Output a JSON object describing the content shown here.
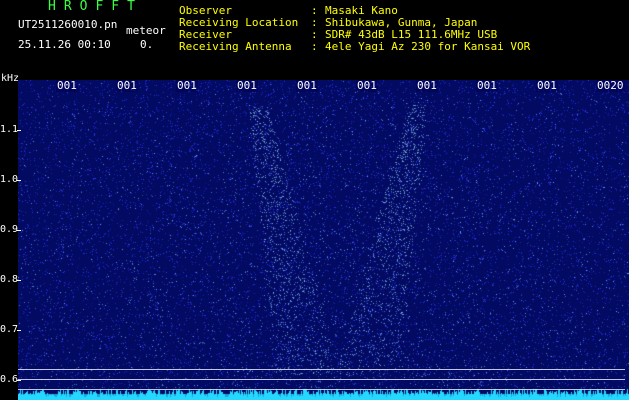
{
  "app": {
    "title": "HROFFT"
  },
  "file": {
    "name": "UT2511260010.pn",
    "detection_label": "meteor",
    "datetime": "25.11.26 00:10",
    "count": "0."
  },
  "info": {
    "observer": {
      "label": "Observer",
      "value": "Masaki Kano"
    },
    "location": {
      "label": "Receiving Location",
      "value": "Shibukawa, Gunma, Japan"
    },
    "receiver": {
      "label": "Receiver",
      "value": "SDR# 43dB L15 111.6MHz USB"
    },
    "antenna": {
      "label": "Receiving Antenna",
      "value": "4ele Yagi Az 230 for Kansai VOR"
    },
    "separator": ":"
  },
  "spectrogram": {
    "unit_label": "kHz",
    "y_labels": [
      "1.1",
      "1.0",
      "0.9",
      "0.8",
      "0.7",
      "0.6"
    ],
    "time_labels": [
      "001",
      "001",
      "001",
      "001",
      "001",
      "001",
      "001",
      "001",
      "001",
      "0020"
    ],
    "colors": {
      "background": "#020a62",
      "noise": "#2b35ff",
      "bright": "#9ad7ff",
      "baseline": "#26d8ff",
      "text_yellow": "#ffff00",
      "text_green": "#39ff45"
    }
  }
}
